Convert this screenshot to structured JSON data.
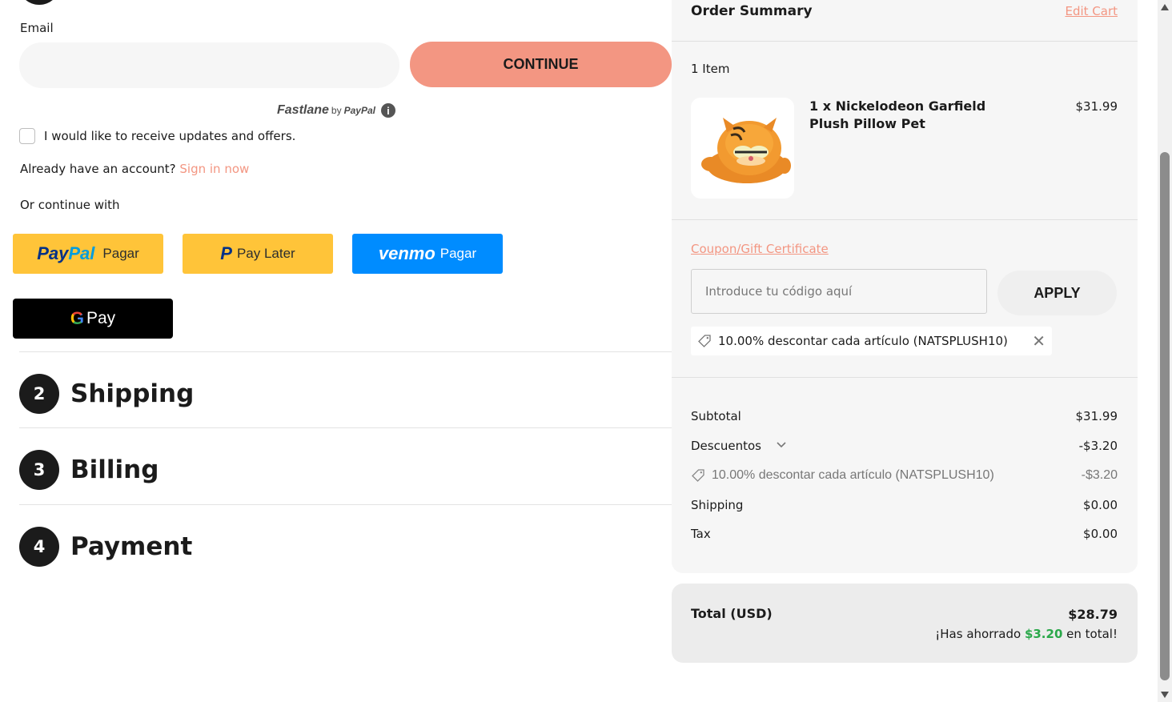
{
  "contact": {
    "email_label": "Email",
    "email_value": "",
    "continue_label": "CONTINUE",
    "fastlane": {
      "brand": "Fastlane",
      "by": "by",
      "paypal": "PayPal",
      "info_glyph": "i"
    },
    "updates_label": "I would like to receive updates and offers.",
    "updates_checked": false,
    "account_prompt": "Already have an account?",
    "signin_label": "Sign in now",
    "or_continue": "Or continue with"
  },
  "payment_buttons": {
    "paypal": {
      "logo_pay": "Pay",
      "logo_pal": "Pal",
      "word": "Pagar"
    },
    "paylater": {
      "logo_glyph": "P",
      "word": "Pay Later"
    },
    "venmo": {
      "logo": "venmo",
      "word": "Pagar"
    },
    "gpay": {
      "logo_g": "G",
      "word": "Pay"
    }
  },
  "steps": [
    {
      "number": "2",
      "title": "Shipping"
    },
    {
      "number": "3",
      "title": "Billing"
    },
    {
      "number": "4",
      "title": "Payment"
    }
  ],
  "summary": {
    "title": "Order Summary",
    "edit_cart": "Edit Cart",
    "item_count": "1 Item",
    "item": {
      "name": "1 x Nickelodeon Garfield Plush Pillow Pet",
      "price": "$31.99"
    },
    "coupon_link": "Coupon/Gift Certificate",
    "coupon_placeholder": "Introduce tu código aquí",
    "apply_label": "APPLY",
    "applied_coupon": "10.00% descontar cada artículo (NATSPLUSH10)",
    "rows": {
      "subtotal": {
        "label": "Subtotal",
        "value": "$31.99"
      },
      "discounts": {
        "label": "Descuentos",
        "value": "-$3.20"
      },
      "discount_detail": {
        "label": "10.00% descontar cada artículo (NATSPLUSH10)",
        "value": "-$3.20"
      },
      "shipping": {
        "label": "Shipping",
        "value": "$0.00"
      },
      "tax": {
        "label": "Tax",
        "value": "$0.00"
      }
    },
    "total": {
      "label": "Total (USD)",
      "value": "$28.79",
      "saved_prefix": "¡Has ahorrado",
      "saved_amount": "$3.20",
      "saved_suffix": "en total!"
    }
  },
  "colors": {
    "accent": "#f39682",
    "paypal_yellow": "#ffc439",
    "venmo_blue": "#008cff",
    "savings_green": "#2aa84a"
  },
  "icons": [
    "info-icon",
    "checkbox-icon",
    "paypal-logo",
    "venmo-logo",
    "google-g-icon",
    "tag-icon",
    "close-icon",
    "chevron-down-icon"
  ]
}
